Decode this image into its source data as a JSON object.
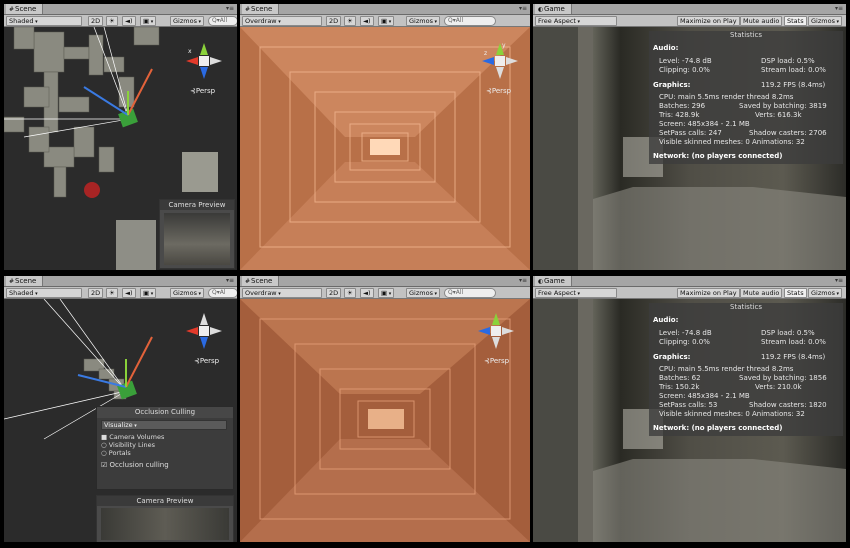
{
  "top": {
    "scene1": {
      "tab": "Scene",
      "shading": "Shaded",
      "btn_2d": "2D",
      "gizmos": "Gizmos",
      "search_placeholder": "Q▾All",
      "persp": "⊰Persp",
      "camera_preview": "Camera Preview"
    },
    "scene2": {
      "tab": "Scene",
      "shading": "Overdraw",
      "btn_2d": "2D",
      "gizmos": "Gizmos",
      "search_placeholder": "Q▾All",
      "persp": "⊰Persp"
    },
    "game": {
      "tab": "Game",
      "aspect": "Free Aspect",
      "maximize": "Maximize on Play",
      "mute": "Mute audio",
      "stats_btn": "Stats",
      "gizmos": "Gizmos",
      "stats": {
        "title": "Statistics",
        "audio_hdr": "Audio:",
        "level": "Level: -74.8 dB",
        "dsp": "DSP load: 0.5%",
        "clipping": "Clipping: 0.0%",
        "stream": "Stream load: 0.0%",
        "graphics_hdr": "Graphics:",
        "fps": "119.2 FPS (8.4ms)",
        "cpu": "CPU: main 5.5ms  render thread 8.2ms",
        "batches": "Batches: 296",
        "saved": "Saved by batching: 3819",
        "tris": "Tris: 428.9k",
        "verts": "Verts: 616.3k",
        "screen": "Screen: 485x384 - 2.1 MB",
        "setpass": "SetPass calls: 247",
        "shadow": "Shadow casters: 2706",
        "skinned": "Visible skinned meshes: 0  Animations: 32",
        "network": "Network: (no players connected)"
      }
    }
  },
  "bottom": {
    "scene1": {
      "tab": "Scene",
      "shading": "Shaded",
      "btn_2d": "2D",
      "gizmos": "Gizmos",
      "search_placeholder": "Q▾Al",
      "persp": "⊰Persp",
      "occlusion": {
        "title": "Occlusion Culling",
        "visualize": "Visualize",
        "camera_volumes": "Camera Volumes",
        "visibility_lines": "Visibility Lines",
        "portals": "Portals",
        "occlusion_culling": "Occlusion culling"
      },
      "camera_preview": "Camera Preview"
    },
    "scene2": {
      "tab": "Scene",
      "shading": "Overdraw",
      "btn_2d": "2D",
      "gizmos": "Gizmos",
      "search_placeholder": "Q▾All",
      "persp": "⊰Persp"
    },
    "game": {
      "tab": "Game",
      "aspect": "Free Aspect",
      "maximize": "Maximize on Play",
      "mute": "Mute audio",
      "stats_btn": "Stats",
      "gizmos": "Gizmos",
      "stats": {
        "title": "Statistics",
        "audio_hdr": "Audio:",
        "level": "Level: -74.8 dB",
        "dsp": "DSP load: 0.5%",
        "clipping": "Clipping: 0.0%",
        "stream": "Stream load: 0.0%",
        "graphics_hdr": "Graphics:",
        "fps": "119.2 FPS (8.4ms)",
        "cpu": "CPU: main 5.5ms  render thread 8.2ms",
        "batches": "Batches: 62",
        "saved": "Saved by batching: 1856",
        "tris": "Tris: 150.2k",
        "verts": "Verts: 210.0k",
        "screen": "Screen: 485x384 - 2.1 MB",
        "setpass": "SetPass calls: 53",
        "shadow": "Shadow casters: 1820",
        "skinned": "Visible skinned meshes: 0  Animations: 32",
        "network": "Network: (no players connected)"
      }
    }
  },
  "gizmo_labels": {
    "x": "x",
    "y": "y",
    "z": "z"
  },
  "icons": [
    "sun-icon",
    "speaker-icon",
    "image-icon",
    "menu-icon",
    "maximize-icon",
    "close-icon"
  ],
  "colors": {
    "overdraw": "#d08a5e",
    "gizmo_x": "#e23a2a",
    "gizmo_y": "#8ad23a",
    "gizmo_z": "#2a6ae2"
  }
}
